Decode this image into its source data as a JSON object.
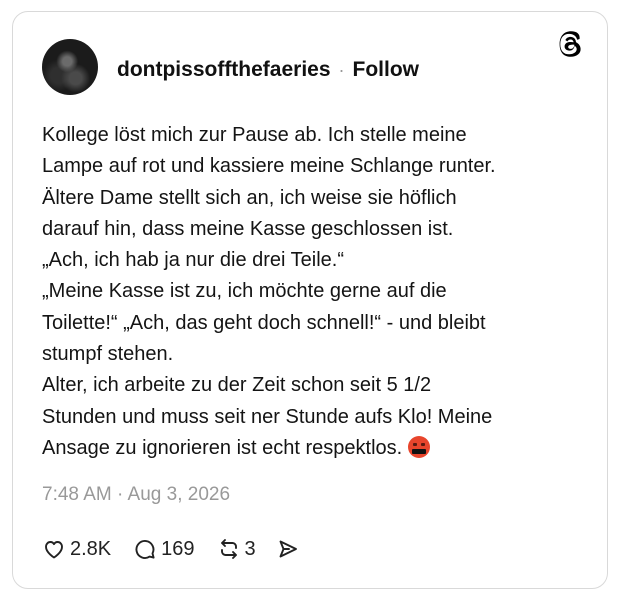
{
  "post": {
    "username": "dontpissoffthefaeries",
    "separator": "·",
    "follow_label": "Follow",
    "text_lines": [
      "Kollege löst mich zur Pause ab. Ich stelle meine",
      "Lampe auf rot und kassiere meine Schlange runter.",
      "Ältere Dame stellt sich an, ich weise sie höflich",
      "darauf hin, dass meine Kasse geschlossen ist.",
      "„Ach, ich hab ja nur die drei Teile.“",
      "„Meine Kasse ist zu, ich möchte gerne auf die",
      "Toilette!“ „Ach, das geht doch schnell!“ - und bleibt",
      "stumpf stehen.",
      "Alter, ich arbeite zu der Zeit schon seit 5 1/2",
      "Stunden und muss seit ner Stunde aufs Klo! Meine",
      "Ansage zu ignorieren ist echt respektlos."
    ],
    "emoji": "face-with-symbols-on-mouth",
    "timestamp": "7:48 AM · Aug 3, 2026"
  },
  "actions": {
    "likes": "2.8K",
    "replies": "169",
    "reposts": "3"
  },
  "icons": {
    "brand": "threads-logo-icon",
    "like": "heart-icon",
    "reply": "speech-bubble-icon",
    "repost": "repost-arrows-icon",
    "share": "send-icon"
  },
  "colors": {
    "text": "#111111",
    "muted": "#999999",
    "border": "#d9d9d9",
    "emoji": "#e8452c"
  }
}
